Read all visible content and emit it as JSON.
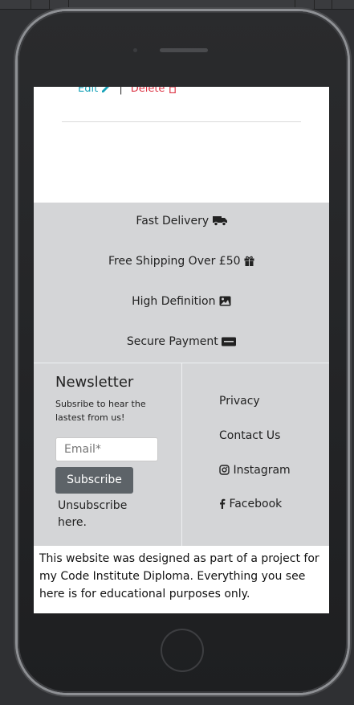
{
  "product": {
    "edit_label": "Edit",
    "delete_label": "Delete",
    "separator": "|"
  },
  "features": [
    {
      "label": "Fast Delivery",
      "icon": "truck-icon"
    },
    {
      "label": "Free Shipping Over £50",
      "icon": "gift-icon"
    },
    {
      "label": "High Definition",
      "icon": "image-icon"
    },
    {
      "label": "Secure Payment",
      "icon": "stripe-icon"
    }
  ],
  "newsletter": {
    "title": "Newsletter",
    "subtitle": "Subsribe to hear the lastest from us!",
    "email_placeholder": "Email*",
    "subscribe_label": "Subscribe",
    "unsubscribe_label": "Unsubscribe here."
  },
  "footer_links": {
    "privacy": "Privacy",
    "contact": "Contact Us",
    "instagram": "Instagram",
    "facebook": "Facebook"
  },
  "disclaimer": "This website was designed as part of a project for my Code Institute Diploma. Everything you see here is for educational purposes only.",
  "colors": {
    "edit": "#17a2b8",
    "delete": "#dc3545",
    "panel_bg": "#d4d5d7",
    "button_bg": "#5d6368"
  }
}
